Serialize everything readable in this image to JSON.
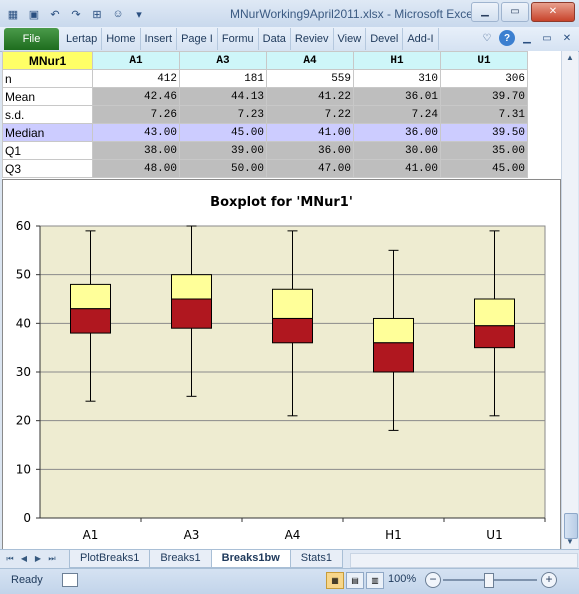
{
  "window": {
    "title": "MNurWorking9April2011.xlsx  -  Microsoft Excel"
  },
  "ribbon": {
    "file_label": "File",
    "tabs": [
      "Lertap",
      "Home",
      "Insert",
      "Page I",
      "Formu",
      "Data",
      "Reviev",
      "View",
      "Devel",
      "Add-I"
    ]
  },
  "table": {
    "headers": [
      "MNur1",
      "A1",
      "A3",
      "A4",
      "H1",
      "U1"
    ],
    "rows": [
      {
        "label": "n",
        "values": [
          "412",
          "181",
          "559",
          "310",
          "306"
        ]
      },
      {
        "label": "Mean",
        "values": [
          "42.46",
          "44.13",
          "41.22",
          "36.01",
          "39.70"
        ]
      },
      {
        "label": "s.d.",
        "values": [
          "7.26",
          "7.23",
          "7.22",
          "7.24",
          "7.31"
        ]
      },
      {
        "label": "Median",
        "values": [
          "43.00",
          "45.00",
          "41.00",
          "36.00",
          "39.50"
        ]
      },
      {
        "label": "Q1",
        "values": [
          "38.00",
          "39.00",
          "36.00",
          "30.00",
          "35.00"
        ]
      },
      {
        "label": "Q3",
        "values": [
          "48.00",
          "50.00",
          "47.00",
          "41.00",
          "45.00"
        ]
      }
    ]
  },
  "chart_data": {
    "type": "boxplot",
    "title": "Boxplot for 'MNur1'",
    "categories": [
      "A1",
      "A3",
      "A4",
      "H1",
      "U1"
    ],
    "min": [
      24,
      25,
      21,
      18,
      21
    ],
    "q1": [
      38,
      39,
      36,
      30,
      35
    ],
    "median": [
      43,
      45,
      41,
      36,
      39.5
    ],
    "q3": [
      48,
      50,
      47,
      41,
      45
    ],
    "max": [
      59,
      60,
      59,
      55,
      59
    ],
    "ylim": [
      0,
      60
    ],
    "yticks": [
      0,
      10,
      20,
      30,
      40,
      50,
      60
    ],
    "grid": true,
    "colors": {
      "lower_box": "#b0171f",
      "upper_box": "#ffff99",
      "plot_bg": "#eeecd1"
    }
  },
  "sheet_tabs": [
    "PlotBreaks1",
    "Breaks1",
    "Breaks1bw",
    "Stats1"
  ],
  "active_sheet": "Breaks1bw",
  "status": {
    "ready": "Ready",
    "zoom": "100%"
  }
}
